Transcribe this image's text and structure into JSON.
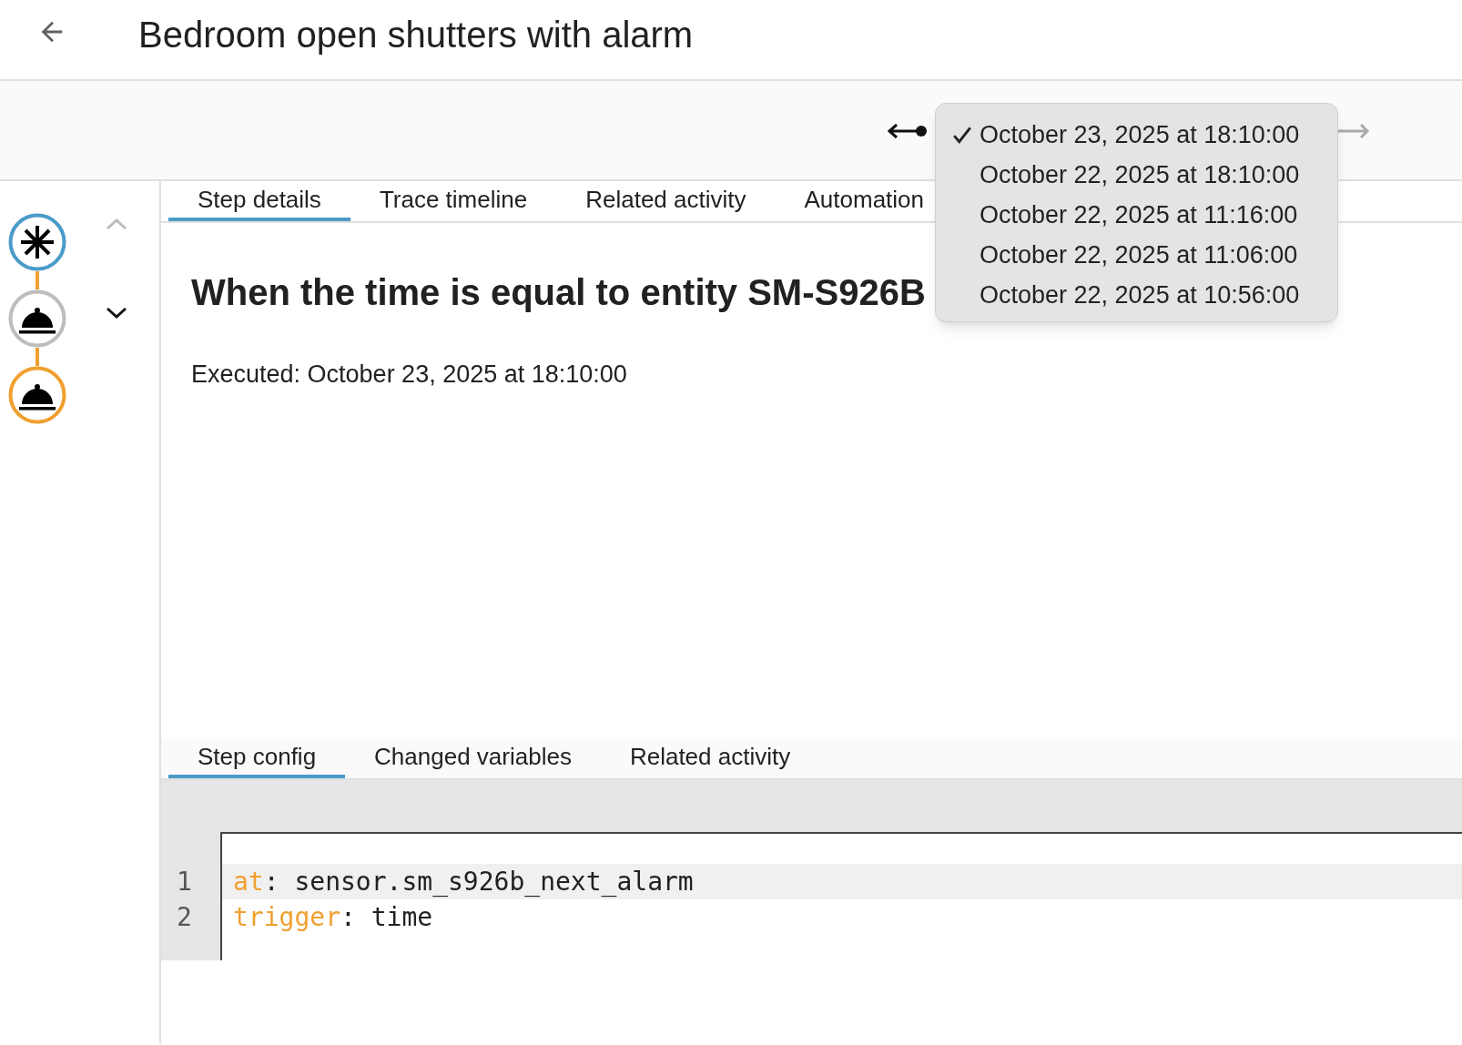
{
  "header": {
    "title": "Bedroom open shutters with alarm"
  },
  "trace_menu": {
    "items": [
      {
        "label": "October 23, 2025 at 18:10:00",
        "selected": true
      },
      {
        "label": "October 22, 2025 at 18:10:00",
        "selected": false
      },
      {
        "label": "October 22, 2025 at 11:16:00",
        "selected": false
      },
      {
        "label": "October 22, 2025 at 11:06:00",
        "selected": false
      },
      {
        "label": "October 22, 2025 at 10:56:00",
        "selected": false
      }
    ]
  },
  "steps": [
    {
      "kind": "trigger",
      "color": "#4a9bc9"
    },
    {
      "kind": "action",
      "color": "#bdbdbd"
    },
    {
      "kind": "action",
      "color": "#f0a030"
    }
  ],
  "tabs": [
    {
      "label": "Step details",
      "selected": true
    },
    {
      "label": "Trace timeline",
      "selected": false
    },
    {
      "label": "Related activity",
      "selected": false
    },
    {
      "label": "Automation",
      "selected": false
    }
  ],
  "step": {
    "heading": "When the time is equal to entity SM-S926B",
    "executed": "Executed: October 23, 2025 at 18:10:00"
  },
  "config_tabs": [
    {
      "label": "Step config",
      "selected": true
    },
    {
      "label": "Changed variables",
      "selected": false
    },
    {
      "label": "Related activity",
      "selected": false
    }
  ],
  "code_lines": [
    {
      "number": "1",
      "key": "at",
      "separator": ":",
      "value": "sensor.sm_s926b_next_alarm",
      "highlighted": true
    },
    {
      "number": "2",
      "key": "trigger",
      "separator": ":",
      "value": "time",
      "highlighted": false
    }
  ]
}
